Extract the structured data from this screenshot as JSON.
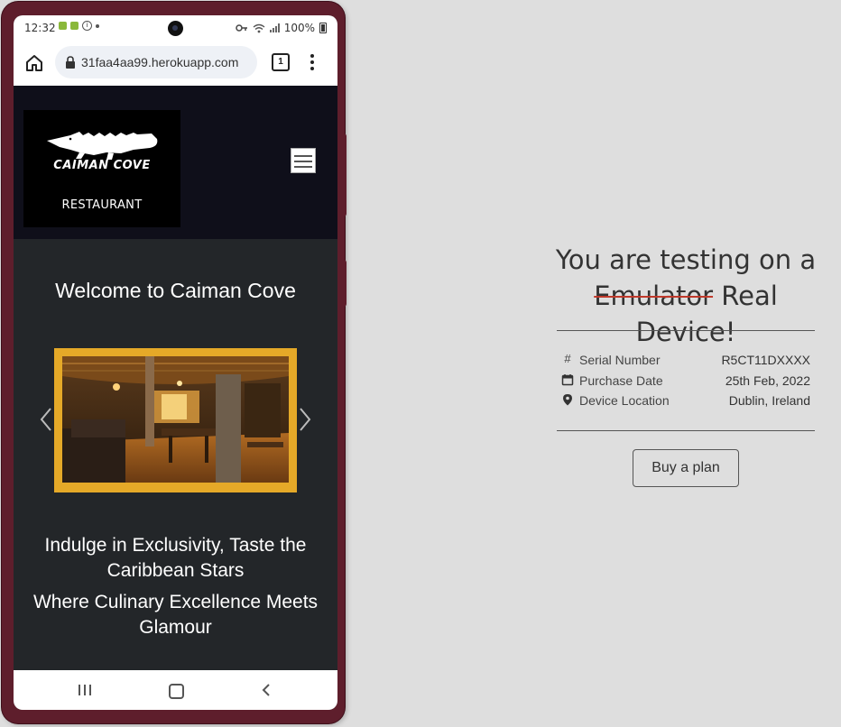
{
  "status_bar": {
    "time": "12:32",
    "battery": "100%"
  },
  "browser": {
    "url": "31faa4aa99.herokuapp.com",
    "tab_count": "1"
  },
  "site": {
    "logo_title": "CAIMAN COVE",
    "logo_subtitle": "RESTAURANT",
    "welcome": "Welcome to Caiman Cove",
    "tagline_1": "Indulge in Exclusivity, Taste the Caribbean Stars",
    "tagline_2": "Where Culinary Excellence Meets Glamour"
  },
  "panel": {
    "heading_prefix": "You are testing on a",
    "heading_struck": "Emulator",
    "heading_rest": "Real Device!",
    "info": {
      "serial_label": "Serial Number",
      "serial_value": "R5CT11DXXXX",
      "purchase_label": "Purchase Date",
      "purchase_value": "25th Feb, 2022",
      "location_label": "Device Location",
      "location_value": "Dublin, Ireland"
    },
    "buy_label": "Buy a plan"
  },
  "colors": {
    "phone_frame": "#5e1e2c",
    "header_bg": "#0f0f1a",
    "main_bg": "#232629",
    "carousel_border": "#e5a928",
    "strike": "#c0392b"
  },
  "icons": [
    "home-icon",
    "lock-icon",
    "tabs-icon",
    "menu-icon",
    "hamburger-icon",
    "chevron-left-icon",
    "chevron-right-icon",
    "hash-icon",
    "calendar-icon",
    "location-pin-icon"
  ]
}
